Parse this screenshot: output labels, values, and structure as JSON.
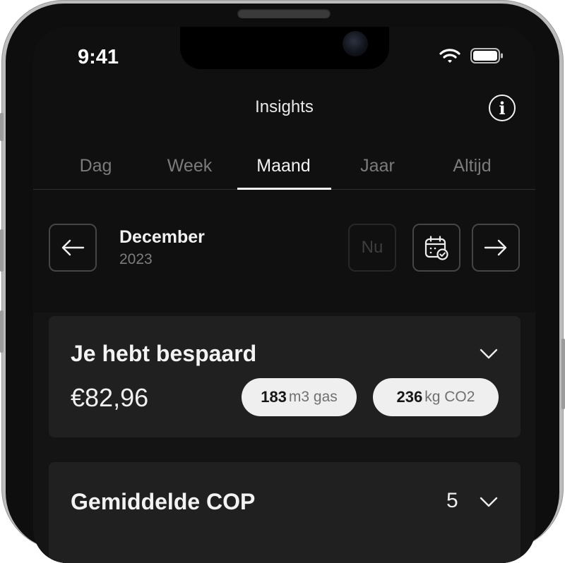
{
  "status_bar": {
    "time": "9:41"
  },
  "header": {
    "title": "Insights",
    "info_icon": "info-circle-icon"
  },
  "tabs": [
    {
      "label": "Dag",
      "active": false
    },
    {
      "label": "Week",
      "active": false
    },
    {
      "label": "Maand",
      "active": true
    },
    {
      "label": "Jaar",
      "active": false
    },
    {
      "label": "Altijd",
      "active": false
    }
  ],
  "period_nav": {
    "month": "December",
    "year": "2023",
    "now_label": "Nu",
    "prev_icon": "arrow-left-icon",
    "calendar_icon": "calendar-check-icon",
    "next_icon": "arrow-right-icon"
  },
  "savings_card": {
    "title": "Je hebt bespaard",
    "amount": "€82,96",
    "gas": {
      "value": "183",
      "unit": "m3 gas"
    },
    "co2": {
      "value": "236",
      "unit": "kg CO2"
    }
  },
  "cop_card": {
    "title": "Gemiddelde COP",
    "value": "5"
  },
  "colors": {
    "background": "#101010",
    "card": "#202020",
    "pill": "#efefef",
    "accent": "#f4f4f4"
  }
}
